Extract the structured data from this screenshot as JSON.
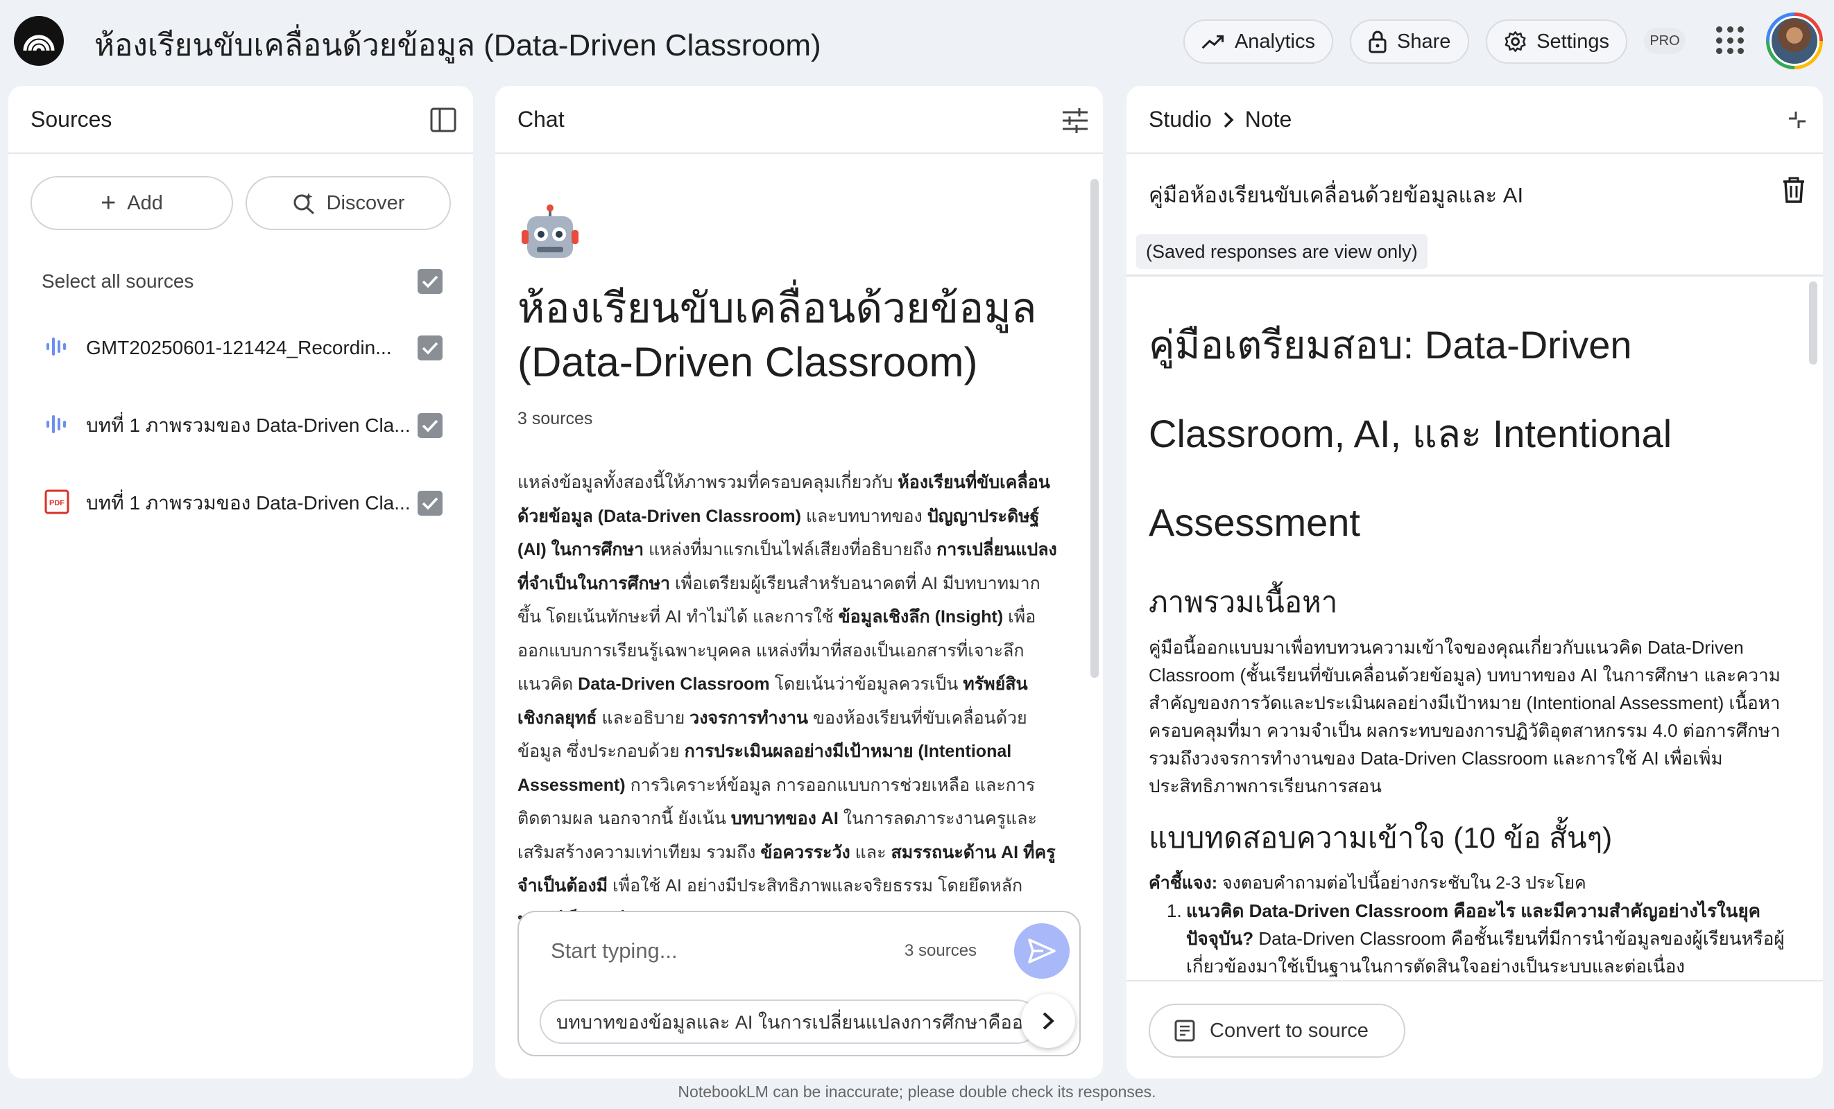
{
  "app": {
    "title": "ห้องเรียนขับเคลื่อนด้วยข้อมูล (Data-Driven Classroom)",
    "analytics_label": "Analytics",
    "share_label": "Share",
    "settings_label": "Settings",
    "pro_badge": "PRO"
  },
  "sources": {
    "title": "Sources",
    "add_label": "Add",
    "discover_label": "Discover",
    "select_all_label": "Select all sources",
    "items": [
      {
        "label": "GMT20250601-121424_Recordin...",
        "icon": "audio-icon",
        "checked": true
      },
      {
        "label": "บทที่ 1 ภาพรวมของ Data-Driven Cla...",
        "icon": "audio-icon",
        "checked": true
      },
      {
        "label": "บทที่ 1 ภาพรวมของ Data-Driven Cla...",
        "icon": "pdf-icon",
        "checked": true
      }
    ]
  },
  "chat": {
    "title": "Chat",
    "emoji": "🤖",
    "notebook_title": "ห้องเรียนขับเคลื่อนด้วยข้อมูล (Data-Driven Classroom)",
    "source_count": "3 sources",
    "summary_parts": [
      {
        "t": "แหล่งข้อมูลทั้งสองนี้ให้ภาพรวมที่ครอบคลุมเกี่ยวกับ ",
        "b": false
      },
      {
        "t": "ห้องเรียนที่ขับเคลื่อนด้วยข้อมูล (Data-Driven Classroom)",
        "b": true
      },
      {
        "t": " และบทบาทของ ",
        "b": false
      },
      {
        "t": "ปัญญาประดิษฐ์ (AI) ในการศึกษา",
        "b": true
      },
      {
        "t": " แหล่งที่มาแรกเป็นไฟล์เสียงที่อธิบายถึง ",
        "b": false
      },
      {
        "t": "การเปลี่ยนแปลงที่จำเป็นในการศึกษา",
        "b": true
      },
      {
        "t": " เพื่อเตรียมผู้เรียนสำหรับอนาคตที่ AI มีบทบาทมากขึ้น โดยเน้นทักษะที่ AI ทำไม่ได้ และการใช้ ",
        "b": false
      },
      {
        "t": "ข้อมูลเชิงลึก (Insight)",
        "b": true
      },
      {
        "t": " เพื่อออกแบบการเรียนรู้เฉพาะบุคคล แหล่งที่มาที่สองเป็นเอกสารที่เจาะลึกแนวคิด ",
        "b": false
      },
      {
        "t": "Data-Driven Classroom",
        "b": true
      },
      {
        "t": " โดยเน้นว่าข้อมูลควรเป็น ",
        "b": false
      },
      {
        "t": "ทรัพย์สินเชิงกลยุทธ์",
        "b": true
      },
      {
        "t": " และอธิบาย ",
        "b": false
      },
      {
        "t": "วงจรการทำงาน",
        "b": true
      },
      {
        "t": " ของห้องเรียนที่ขับเคลื่อนด้วยข้อมูล ซึ่งประกอบด้วย ",
        "b": false
      },
      {
        "t": "การประเมินผลอย่างมีเป้าหมาย (Intentional Assessment)",
        "b": true
      },
      {
        "t": " การวิเคราะห์ข้อมูล การออกแบบการช่วยเหลือ และการติดตามผล นอกจากนี้ ยังเน้น ",
        "b": false
      },
      {
        "t": "บทบาทของ AI",
        "b": true
      },
      {
        "t": " ในการลดภาระงานครูและเสริมสร้างความเท่าเทียม รวมถึง ",
        "b": false
      },
      {
        "t": "ข้อควรระวัง",
        "b": true
      },
      {
        "t": " และ ",
        "b": false
      },
      {
        "t": "สมรรถนะด้าน AI ที่ครูจำเป็นต้องมี",
        "b": true
      },
      {
        "t": " เพื่อใช้ AI อย่างมีประสิทธิภาพและจริยธรรม โดยยึดหลัก ",
        "b": false
      },
      {
        "t": "มนุษย์เป็นศูนย์กลาง (Human-Centered Mindset)",
        "b": true
      }
    ],
    "input_placeholder": "Start typing...",
    "input_source_count": "3 sources",
    "suggestion": "บทบาทของข้อมูลและ AI ในการเปลี่ยนแปลงการศึกษาคืออะไร"
  },
  "studio": {
    "breadcrumb_root": "Studio",
    "breadcrumb_current": "Note",
    "note_title": "คู่มือห้องเรียนขับเคลื่อนด้วยข้อมูลและ AI",
    "view_only_notice": "(Saved responses are view only)",
    "heading": "คู่มือเตรียมสอบ: Data-Driven Classroom, AI, และ Intentional Assessment",
    "section1_title": "ภาพรวมเนื้อหา",
    "section1_body": "คู่มือนี้ออกแบบมาเพื่อทบทวนความเข้าใจของคุณเกี่ยวกับแนวคิด Data-Driven Classroom (ชั้นเรียนที่ขับเคลื่อนด้วยข้อมูล) บทบาทของ AI ในการศึกษา และความสำคัญของการวัดและประเมินผลอย่างมีเป้าหมาย (Intentional Assessment) เนื้อหาครอบคลุมที่มา ความจำเป็น ผลกระทบของการปฏิวัติอุตสาหกรรม 4.0 ต่อการศึกษา รวมถึงวงจรการทำงานของ Data-Driven Classroom และการใช้ AI เพื่อเพิ่มประสิทธิภาพการเรียนการสอน",
    "section2_title": "แบบทดสอบความเข้าใจ (10 ข้อ สั้นๆ)",
    "instruction_label": "คำชี้แจง:",
    "instruction_text": " จงตอบคำถามต่อไปนี้อย่างกระชับใน 2-3 ประโยค",
    "q1_number": "1.",
    "q1_question": "แนวคิด Data-Driven Classroom คืออะไร และมีความสำคัญอย่างไรในยุคปัจจุบัน?",
    "q1_answer": " Data-Driven Classroom คือชั้นเรียนที่มีการนำข้อมูลของผู้เรียนหรือผู้เกี่ยวข้องมาใช้เป็นฐานในการตัดสินใจอย่างเป็นระบบและต่อเนื่อง",
    "convert_label": "Convert to source"
  },
  "footer": {
    "disclaimer": "NotebookLM can be inaccurate; please double check its responses."
  }
}
